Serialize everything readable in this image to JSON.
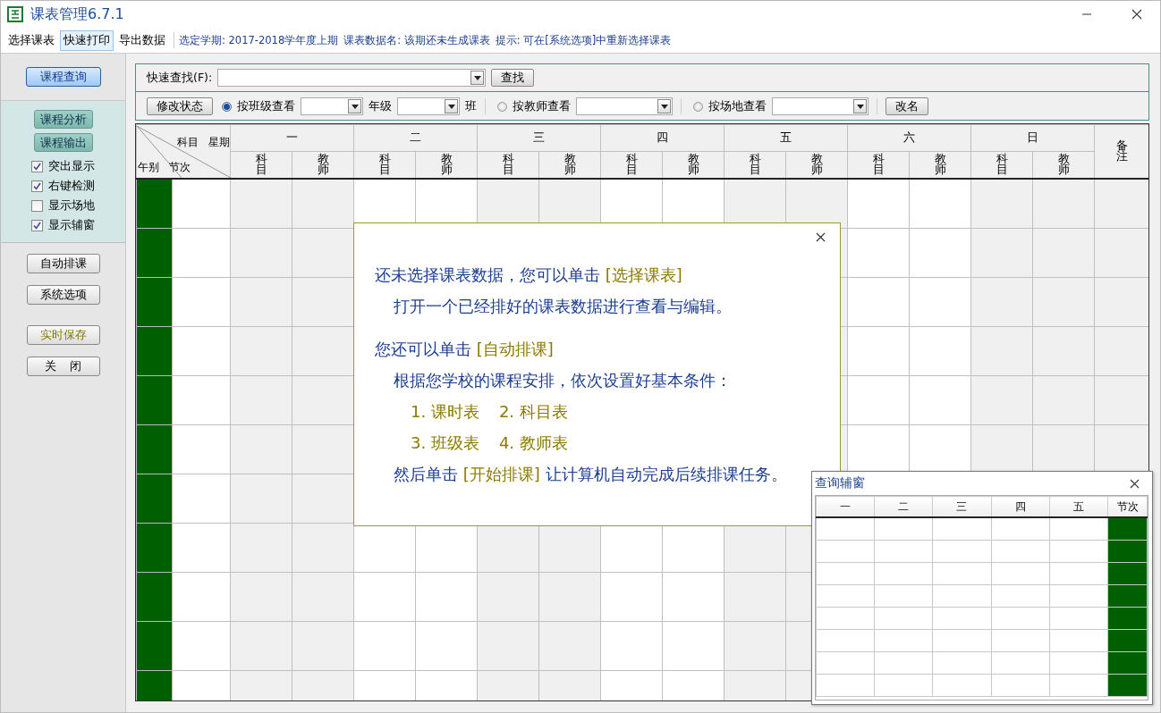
{
  "window": {
    "title": "课表管理6.7.1"
  },
  "menu": [
    {
      "label": "选择课表",
      "selected": false
    },
    {
      "label": "快速打印",
      "selected": true
    },
    {
      "label": "导出数据",
      "selected": false
    }
  ],
  "info": [
    "选定学期: 2017-2018学年度上期",
    "课表数据名: 该期还未生成课表",
    "提示: 可在[系统选项]中重新选择课表"
  ],
  "sidebar": {
    "query_button": {
      "label": "课程查询",
      "selected": true
    },
    "panel_buttons": [
      "课程分析",
      "课程输出"
    ],
    "checkboxes": [
      {
        "label": "突出显示",
        "checked": true
      },
      {
        "label": "右键检测",
        "checked": true
      },
      {
        "label": "显示场地",
        "checked": false
      },
      {
        "label": "显示辅窗",
        "checked": true
      }
    ],
    "buttons": [
      {
        "label": "自动排课",
        "kind": "plain"
      },
      {
        "label": "系统选项",
        "kind": "plain"
      },
      {
        "label": "实时保存",
        "kind": "highlight"
      },
      {
        "label": "关    闭",
        "kind": "plain"
      }
    ]
  },
  "toolbar": {
    "quick_find": {
      "label": "快速查找(F):",
      "button": "查找"
    },
    "controls": [
      {
        "kind": "button",
        "label": "修改状态"
      },
      {
        "kind": "radio",
        "label": "按班级查看",
        "selected": true
      },
      {
        "kind": "combo"
      },
      {
        "kind": "label",
        "label": "年级"
      },
      {
        "kind": "combo"
      },
      {
        "kind": "label",
        "label": "班"
      },
      {
        "kind": "separator"
      },
      {
        "kind": "radio",
        "label": "按教师查看",
        "selected": false
      },
      {
        "kind": "wide_combo"
      },
      {
        "kind": "separator"
      },
      {
        "kind": "radio",
        "label": "按场地查看",
        "selected": false
      },
      {
        "kind": "wide_combo"
      },
      {
        "kind": "separator"
      },
      {
        "kind": "button",
        "label": "改名"
      }
    ]
  },
  "timetable": {
    "corner": {
      "subject": "科目",
      "weekday": "星期",
      "period_group": "午别",
      "period": "节次"
    },
    "days": [
      {
        "label": "一",
        "columns": [
          "科目",
          "教师"
        ]
      },
      {
        "label": "二",
        "columns": [
          "科目",
          "教师"
        ]
      },
      {
        "label": "三",
        "columns": [
          "科目",
          "教师"
        ]
      },
      {
        "label": "四",
        "columns": [
          "科目",
          "教师"
        ]
      },
      {
        "label": "五",
        "columns": [
          "科目",
          "教师"
        ]
      },
      {
        "label": "六",
        "columns": [
          "科目",
          "教师"
        ]
      },
      {
        "label": "日",
        "columns": [
          "科目",
          "教师"
        ]
      }
    ],
    "notes": "备注"
  },
  "dialog": {
    "paragraphs": [
      {
        "parts": [
          {
            "kind": "text",
            "text": "还未选择课表数据，您可以单击 "
          },
          {
            "kind": "link",
            "text": "[选择课表]"
          }
        ],
        "children": [
          {
            "parts": [
              {
                "kind": "text",
                "text": "打开一个已经排好的课表数据进行查看与编辑。"
              }
            ]
          }
        ]
      },
      {
        "parts": [
          {
            "kind": "text",
            "text": "您还可以单击 "
          },
          {
            "kind": "link",
            "text": "[自动排课]"
          }
        ],
        "children": [
          {
            "parts": [
              {
                "kind": "text",
                "text": "根据您学校的课程安排，依次设置好基本条件："
              }
            ],
            "children": [
              {
                "parts": [
                  {
                    "kind": "link",
                    "text": "1. 课时表"
                  },
                  {
                    "kind": "link",
                    "text": "2. 科目表"
                  }
                ]
              },
              {
                "parts": [
                  {
                    "kind": "link",
                    "text": "3. 班级表"
                  },
                  {
                    "kind": "link",
                    "text": "4. 教师表"
                  }
                ]
              }
            ]
          },
          {
            "parts": [
              {
                "kind": "text",
                "text": "然后单击 "
              },
              {
                "kind": "link",
                "text": "[开始排课]"
              },
              {
                "kind": "text",
                "text": " 让计算机自动完成后续排课任务。"
              }
            ]
          }
        ]
      }
    ]
  },
  "aux_window": {
    "title": "查询辅窗",
    "columns": [
      "一",
      "二",
      "三",
      "四",
      "五",
      "节次"
    ]
  }
}
